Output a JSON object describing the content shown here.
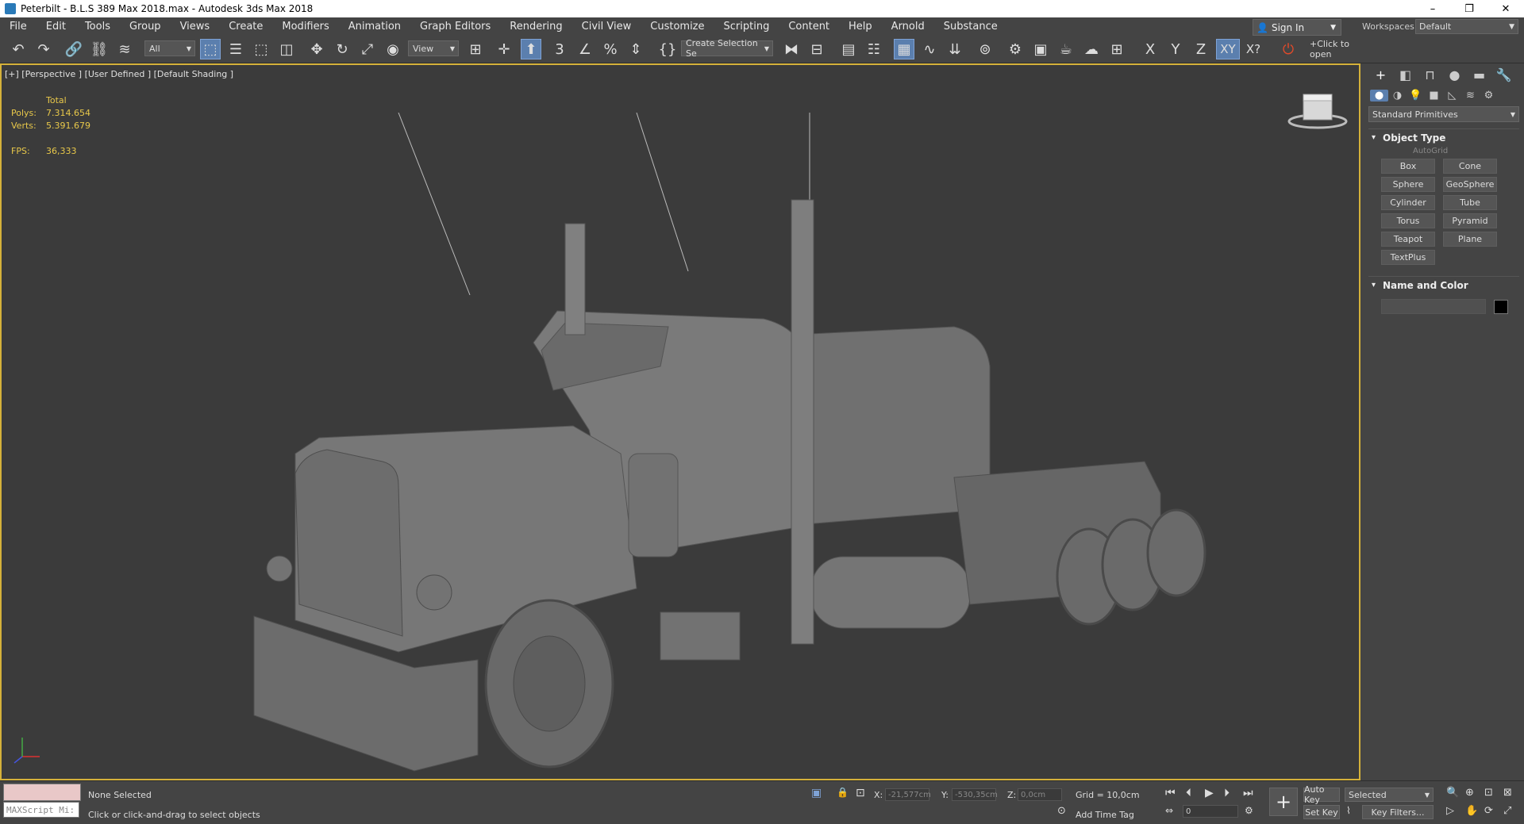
{
  "window": {
    "title": "Peterbilt - B.L.S 389 Max 2018.max - Autodesk 3ds Max 2018",
    "minimize": "–",
    "restore": "❐",
    "close": "✕"
  },
  "menu": [
    "File",
    "Edit",
    "Tools",
    "Group",
    "Views",
    "Create",
    "Modifiers",
    "Animation",
    "Graph Editors",
    "Rendering",
    "Civil View",
    "Customize",
    "Scripting",
    "Content",
    "Help",
    "Arnold",
    "Substance"
  ],
  "account": {
    "sign_in": "Sign In",
    "workspaces_label": "Workspaces:",
    "workspace": "Default"
  },
  "toolbar": {
    "selection_filter": "All",
    "ref_coord": "View",
    "named_selection": "Create Selection Se",
    "axis_x": "X",
    "axis_y": "Y",
    "axis_z": "Z",
    "axis_xy": "XY",
    "axis_xq": "X?",
    "click_to_open": "+Click to open"
  },
  "viewport": {
    "label": "[+] [Perspective ] [User Defined ] [Default Shading ]",
    "stats": {
      "total_label": "Total",
      "polys_label": "Polys:",
      "polys": "7.314.654",
      "verts_label": "Verts:",
      "verts": "5.391.679",
      "fps_label": "FPS:",
      "fps": "36,333"
    }
  },
  "command_panel": {
    "category": "Standard Primitives",
    "object_type_title": "Object Type",
    "autogrid": "AutoGrid",
    "buttons": [
      "Box",
      "Cone",
      "Sphere",
      "GeoSphere",
      "Cylinder",
      "Tube",
      "Torus",
      "Pyramid",
      "Teapot",
      "Plane",
      "TextPlus"
    ],
    "name_color_title": "Name and Color",
    "object_color": "#000000"
  },
  "status": {
    "maxscript": "MAXScript Mi:",
    "selection": "None Selected",
    "prompt": "Click or click-and-drag to select objects",
    "x_label": "X:",
    "x_value": "-21,577cm",
    "y_label": "Y:",
    "y_value": "-530,35cm",
    "z_label": "Z:",
    "z_value": "0,0cm",
    "grid": "Grid = 10,0cm",
    "add_time_tag": "Add Time Tag",
    "frame": "0",
    "auto_key": "Auto Key",
    "set_key": "Set Key",
    "selected": "Selected",
    "key_filters": "Key Filters..."
  },
  "colors": {
    "viewport_border": "#d5b13a",
    "stats_text": "#e8c84a",
    "active_button": "#5b7fae"
  }
}
